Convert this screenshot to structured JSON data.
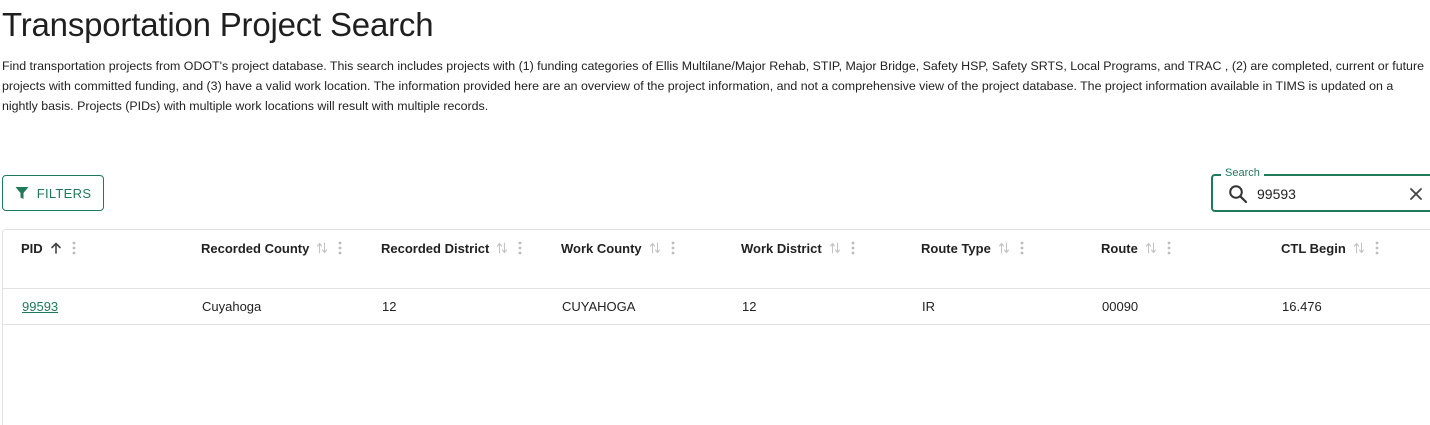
{
  "page": {
    "title": "Transportation Project Search",
    "description": "Find transportation projects from ODOT's project database. This search includes projects with (1) funding categories of Ellis Multilane/Major Rehab, STIP, Major Bridge, Safety HSP, Safety SRTS, Local Programs, and TRAC , (2) are completed, current or future projects with committed funding, and (3) have a valid work location. The information provided here are an overview of the project information, and not a comprehensive view of the project database. The project information available in TIMS is updated on a nightly basis. Projects (PIDs) with multiple work locations will result with multiple records."
  },
  "toolbar": {
    "filters_label": "FILTERS",
    "filters_icon": "filter-icon"
  },
  "search": {
    "label": "Search",
    "value": "99593",
    "icons": [
      "search-icon",
      "close-icon"
    ]
  },
  "colors": {
    "accent": "#1f7a5a",
    "border": "#e2e2e2",
    "sort_inactive": "#c4c4c4",
    "text": "#222222"
  },
  "table": {
    "columns": [
      {
        "label": "PID",
        "sort": "ascending"
      },
      {
        "label": "Recorded County",
        "sort": "none"
      },
      {
        "label": "Recorded District",
        "sort": "none"
      },
      {
        "label": "Work County",
        "sort": "none"
      },
      {
        "label": "Work District",
        "sort": "none"
      },
      {
        "label": "Route Type",
        "sort": "none"
      },
      {
        "label": "Route",
        "sort": "none"
      },
      {
        "label": "CTL Begin",
        "sort": "none"
      }
    ],
    "rows": [
      [
        "99593",
        "Cuyahoga",
        "12",
        "CUYAHOGA",
        "12",
        "IR",
        "00090",
        "16.476"
      ]
    ]
  }
}
